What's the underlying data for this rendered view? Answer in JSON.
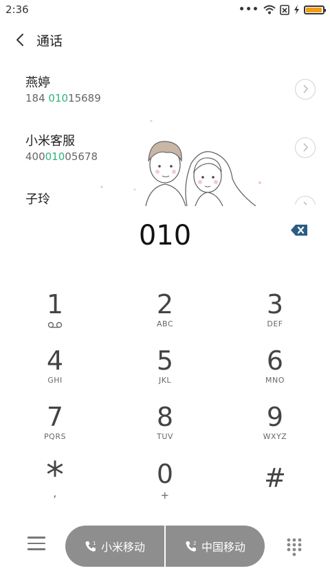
{
  "status": {
    "time": "2:36",
    "battery_level": 0.95
  },
  "header": {
    "title": "通话"
  },
  "contacts": [
    {
      "name": "燕婷",
      "num_pre": "184 ",
      "num_hl": "010",
      "num_post": "15689"
    },
    {
      "name": "小米客服",
      "num_pre": "400",
      "num_hl": "010",
      "num_post": "05678"
    },
    {
      "name": "子玲",
      "num_pre": "",
      "num_hl": "",
      "num_post": ""
    }
  ],
  "dialed_number": "010",
  "keypad": [
    {
      "digit": "1",
      "letters": ""
    },
    {
      "digit": "2",
      "letters": "ABC"
    },
    {
      "digit": "3",
      "letters": "DEF"
    },
    {
      "digit": "4",
      "letters": "GHI"
    },
    {
      "digit": "5",
      "letters": "JKL"
    },
    {
      "digit": "6",
      "letters": "MNO"
    },
    {
      "digit": "7",
      "letters": "PQRS"
    },
    {
      "digit": "8",
      "letters": "TUV"
    },
    {
      "digit": "9",
      "letters": "WXYZ"
    },
    {
      "digit": "*",
      "letters": ","
    },
    {
      "digit": "0",
      "letters": "+"
    },
    {
      "digit": "#",
      "letters": ""
    }
  ],
  "call": {
    "sim1_label": "小米移动",
    "sim2_label": "中国移动"
  },
  "colors": {
    "highlight": "#2fb37a",
    "accent_icon": "#2a5d84",
    "call_bg": "#8e8e8e"
  }
}
